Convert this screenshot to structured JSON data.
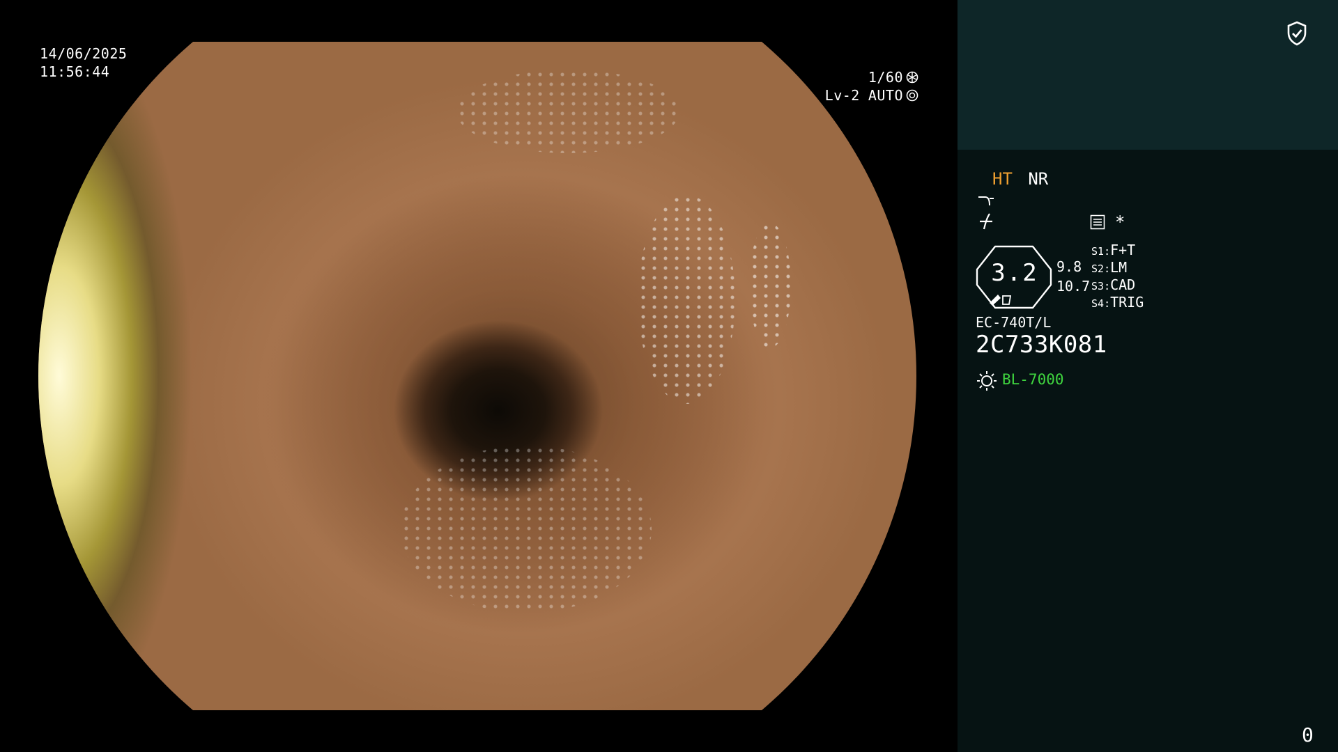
{
  "overlay": {
    "date": "14/06/2025",
    "time": "11:56:44",
    "shutter": "1/60",
    "exposure_level": "Lv-2",
    "exposure_mode": "AUTO"
  },
  "panel": {
    "ht_label": "HT",
    "nr_label": "NR",
    "asterisk": "*",
    "zoom_value": "3.2",
    "scale_top": "9.8",
    "scale_bottom": "10.7",
    "switches": [
      {
        "key": "S1",
        "value": "F+T"
      },
      {
        "key": "S2",
        "value": "LM"
      },
      {
        "key": "S3",
        "value": "CAD"
      },
      {
        "key": "S4",
        "value": "TRIG"
      }
    ],
    "scope_model": "EC-740T/L",
    "serial": "2C733K081",
    "light_source": "BL-7000",
    "counter": "0"
  },
  "colors": {
    "ht": "#f0a030",
    "light_source": "#3fd53f",
    "top_panel": "#0e2628",
    "side_panel": "#061313"
  },
  "icons": [
    "shield-check-icon",
    "shutter-icon",
    "aperture-icon",
    "curve-icon",
    "contrast-icon",
    "menu-list-icon",
    "sun-icon"
  ]
}
